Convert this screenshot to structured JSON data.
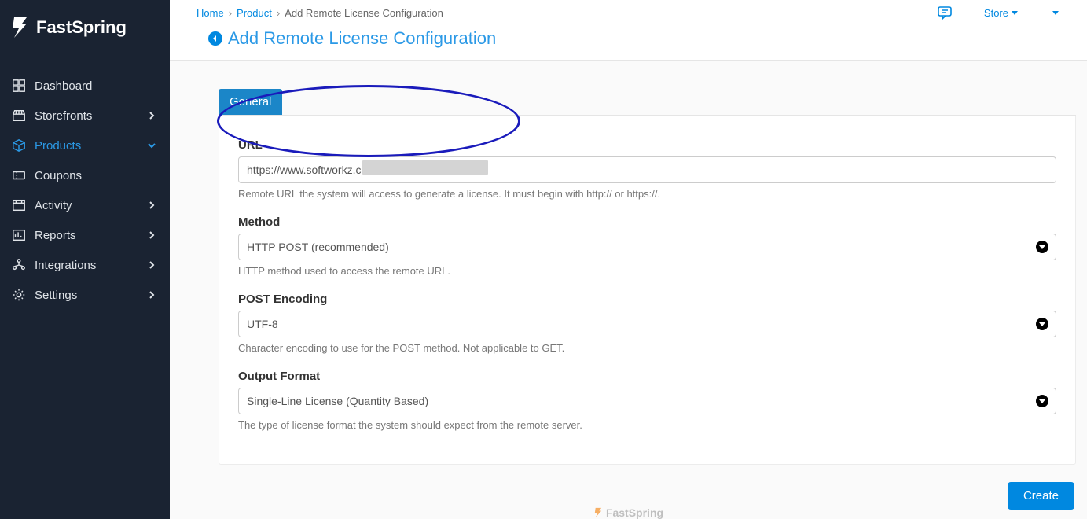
{
  "brand": "FastSpring",
  "sidebar": {
    "items": [
      {
        "label": "Dashboard",
        "icon": "dashboard",
        "expandable": false
      },
      {
        "label": "Storefronts",
        "icon": "storefronts",
        "expandable": true,
        "open": false
      },
      {
        "label": "Products",
        "icon": "products",
        "expandable": true,
        "open": true,
        "active": true
      },
      {
        "label": "Coupons",
        "icon": "coupons",
        "expandable": false
      },
      {
        "label": "Activity",
        "icon": "activity",
        "expandable": true,
        "open": false
      },
      {
        "label": "Reports",
        "icon": "reports",
        "expandable": true,
        "open": false
      },
      {
        "label": "Integrations",
        "icon": "integrations",
        "expandable": true,
        "open": false
      },
      {
        "label": "Settings",
        "icon": "settings",
        "expandable": true,
        "open": false
      }
    ]
  },
  "breadcrumb": {
    "items": [
      {
        "label": "Home",
        "link": true
      },
      {
        "label": "Product",
        "link": true
      },
      {
        "label": "Add Remote License Configuration",
        "link": false
      }
    ]
  },
  "topbar": {
    "store_dropdown": "Store",
    "user_dropdown": ""
  },
  "page_title": "Add Remote License Configuration",
  "tabs": [
    {
      "label": "General",
      "active": true
    }
  ],
  "form": {
    "url": {
      "label": "URL",
      "value": "https://www.softworkz.com/",
      "help": "Remote URL the system will access to generate a license. It must begin with http:// or https://."
    },
    "method": {
      "label": "Method",
      "value": "HTTP POST (recommended)",
      "help": "HTTP method used to access the remote URL."
    },
    "post_encoding": {
      "label": "POST Encoding",
      "value": "UTF-8",
      "help": "Character encoding to use for the POST method. Not applicable to GET."
    },
    "output_format": {
      "label": "Output Format",
      "value": "Single-Line License (Quantity Based)",
      "help": "The type of license format the system should expect from the remote server."
    }
  },
  "actions": {
    "create": "Create"
  }
}
